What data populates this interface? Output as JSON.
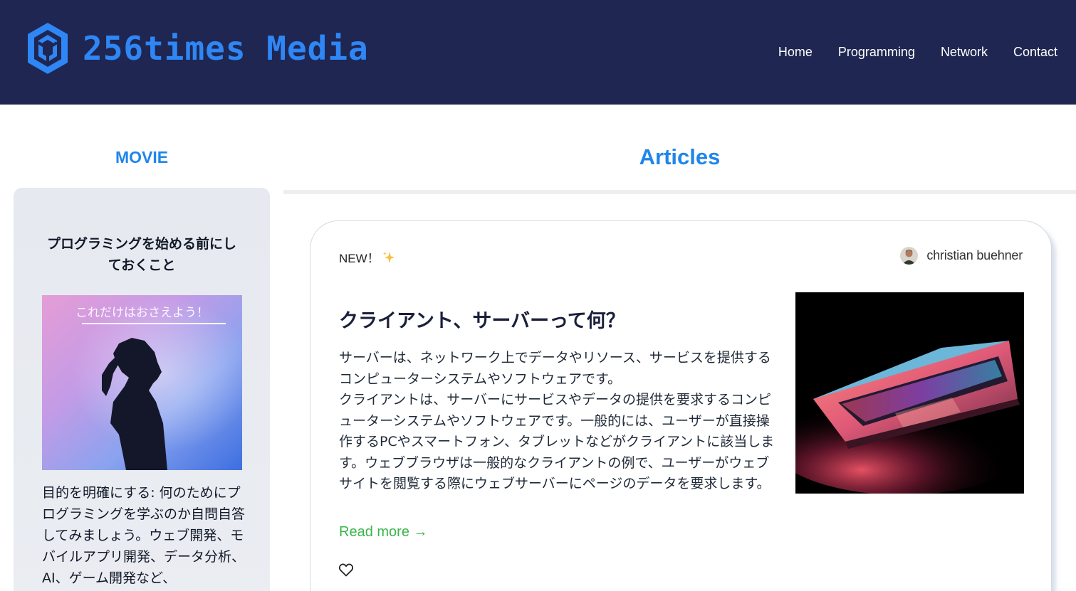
{
  "header": {
    "brand": "256times Media",
    "nav": [
      "Home",
      "Programming",
      "Network",
      "Contact"
    ]
  },
  "sidebar": {
    "title": "MOVIE",
    "card": {
      "heading": "プログラミングを始める前にしておくこと",
      "image_caption": "これだけはおさえよう！",
      "text": "目的を明確にする: 何のためにプログラミングを学ぶのか自問自答してみましょう。ウェブ開発、モバイルアプリ開発、データ分析、AI、ゲーム開発など、"
    }
  },
  "main": {
    "title": "Articles",
    "article": {
      "badge": "NEW！",
      "author": "christian buehner",
      "title": "クライアント、サーバーって何？",
      "body": "サーバーは、ネットワーク上でデータやリソース、サービスを提供するコンピューターシステムやソフトウェアです。\nクライアントは、サーバーにサービスやデータの提供を要求するコンピューターシステムやソフトウェアです。一般的には、ユーザーが直接操作するPCやスマートフォン、タブレットなどがクライアントに該当します。ウェブブラウザは一般的なクライアントの例で、ユーザーがウェブサイトを閲覧する際にウェブサーバーにページのデータを要求します。",
      "read_more": "Read more →"
    }
  },
  "icons": {
    "logo": "hexagon-cube-logo-icon",
    "badge": "sparkle-icon",
    "like": "heart-icon"
  },
  "colors": {
    "header_bg": "#1e2651",
    "brand": "#2f86f5",
    "section_title": "#1f86ea",
    "read_more": "#39b54a"
  }
}
